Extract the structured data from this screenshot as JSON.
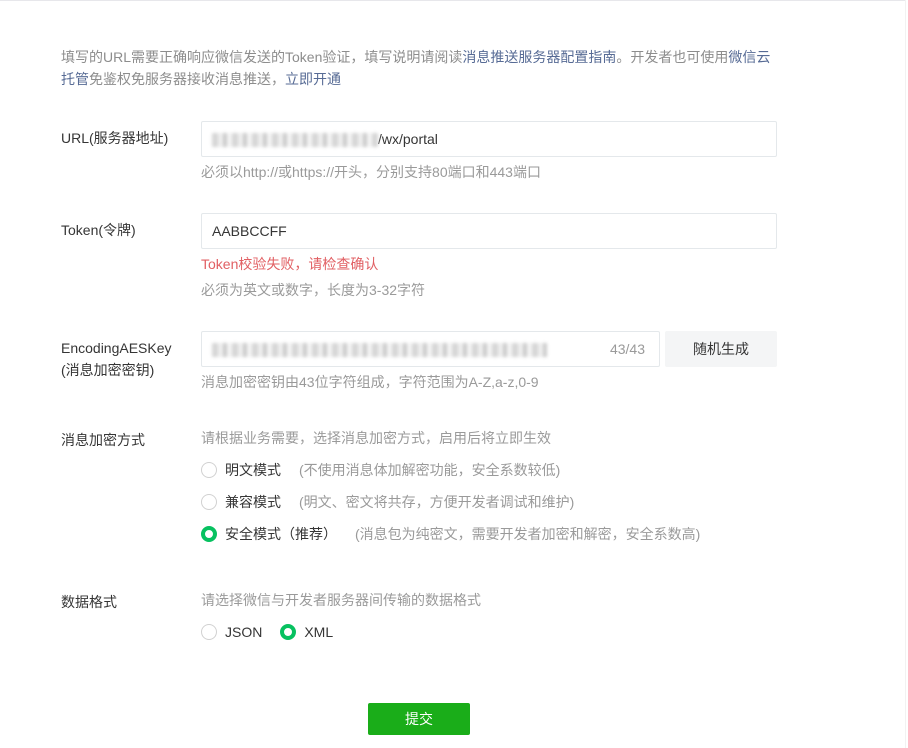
{
  "intro": {
    "p1": "填写的URL需要正确响应微信发送的Token验证，填写说明请阅读",
    "link1": "消息推送服务器配置指南",
    "p2": "。开发者也可使用",
    "link2": "微信云托管",
    "p3": "免鉴权免服务器接收消息推送，",
    "link3": "立即开通"
  },
  "url": {
    "label": "URL(服务器地址)",
    "value_suffix": "/wx/portal",
    "hint": "必须以http://或https://开头，分别支持80端口和443端口"
  },
  "token": {
    "label": "Token(令牌)",
    "value": "AABBCCFF",
    "error": "Token校验失败，请检查确认",
    "hint": "必须为英文或数字，长度为3-32字符"
  },
  "aes": {
    "label1": "EncodingAESKey",
    "label2": "(消息加密密钥)",
    "counter": "43/43",
    "generate": "随机生成",
    "hint": "消息加密密钥由43位字符组成，字符范围为A-Z,a-z,0-9"
  },
  "encrypt": {
    "label": "消息加密方式",
    "hint": "请根据业务需要，选择消息加密方式，启用后将立即生效",
    "options": [
      {
        "label": "明文模式",
        "desc": "(不使用消息体加解密功能，安全系数较低)",
        "checked": false
      },
      {
        "label": "兼容模式",
        "desc": "(明文、密文将共存，方便开发者调试和维护)",
        "checked": false
      },
      {
        "label": "安全模式（推荐）",
        "desc": "(消息包为纯密文，需要开发者加密和解密，安全系数高)",
        "checked": true
      }
    ]
  },
  "format": {
    "label": "数据格式",
    "hint": "请选择微信与开发者服务器间传输的数据格式",
    "options": [
      {
        "label": "JSON",
        "checked": false
      },
      {
        "label": "XML",
        "checked": true
      }
    ]
  },
  "submit": "提交",
  "colors": {
    "accent": "#07c160",
    "submit": "#1aad19",
    "error": "#e15f63",
    "link": "#576b95"
  }
}
